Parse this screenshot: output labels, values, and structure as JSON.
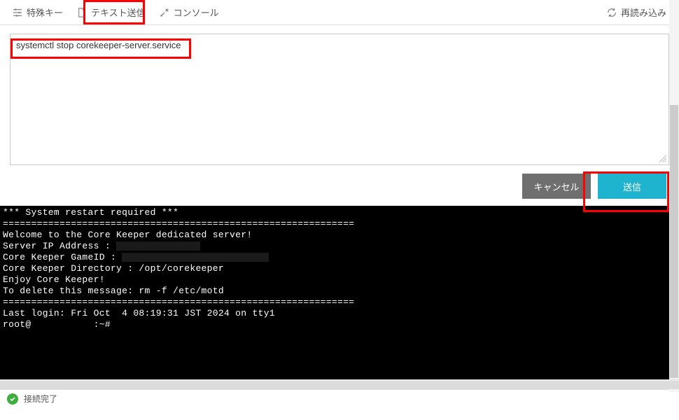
{
  "toolbar": {
    "special_keys": "特殊キー",
    "text_send": "テキスト送信",
    "console": "コンソール",
    "reload": "再読み込み"
  },
  "input": {
    "text": "systemctl stop corekeeper-server.service"
  },
  "buttons": {
    "cancel": "キャンセル",
    "submit": "送信"
  },
  "terminal": {
    "lines": [
      "*** System restart required ***",
      "==============================================================",
      "Welcome to the Core Keeper dedicated server!",
      "",
      "Server IP Address : ",
      "",
      "Core Keeper GameID : ",
      "",
      "Core Keeper Directory : /opt/corekeeper",
      "",
      "Enjoy Core Keeper!",
      "",
      "To delete this message: rm -f /etc/motd",
      "==============================================================",
      "Last login: Fri Oct  4 08:19:31 JST 2024 on tty1",
      "root@           :~# "
    ]
  },
  "status": {
    "text": "接続完了"
  }
}
